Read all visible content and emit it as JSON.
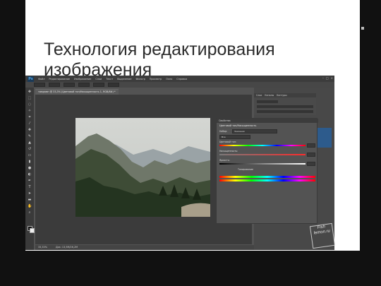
{
  "slide": {
    "title": "Технология редактирования\nизображения"
  },
  "photoshop": {
    "logo": "Ps",
    "menu": [
      "Файл",
      "Редактирование",
      "Изображение",
      "Слои",
      "Текст",
      "Выделение",
      "Фильтр",
      "Просмотр",
      "Окно",
      "Справка"
    ],
    "document_tab": "тамрамп @ 33,3% (Цветовой тон/Насыщенность 1, RGB/8#) *",
    "zoom_status": "33,33%",
    "doc_status": "Док: 13,5M/26,2M",
    "panel_tabs": [
      "Слои",
      "Каналы",
      "Контуры"
    ],
    "properties": {
      "header": "Свойства",
      "subtitle": "Цветовой тон/Насыщенность",
      "preset_label": "Набор:",
      "preset_value": "Заказная",
      "channel_value": "Все",
      "hue_label": "Цветовой тон:",
      "saturation_label": "Насыщенность:",
      "lightness_label": "Яркость:",
      "colorize_label": "Тонирование"
    },
    "icons": [
      "eye-icon",
      "chevron-down-icon",
      "close-icon",
      "minimize-icon",
      "maximize-icon"
    ],
    "colors": {
      "app_bg": "#535353",
      "menu_bg": "#3c3c3c",
      "accent_blue": "#2d5b8c"
    }
  },
  "watermark": {
    "text": "Fish\nlemon.ru"
  }
}
